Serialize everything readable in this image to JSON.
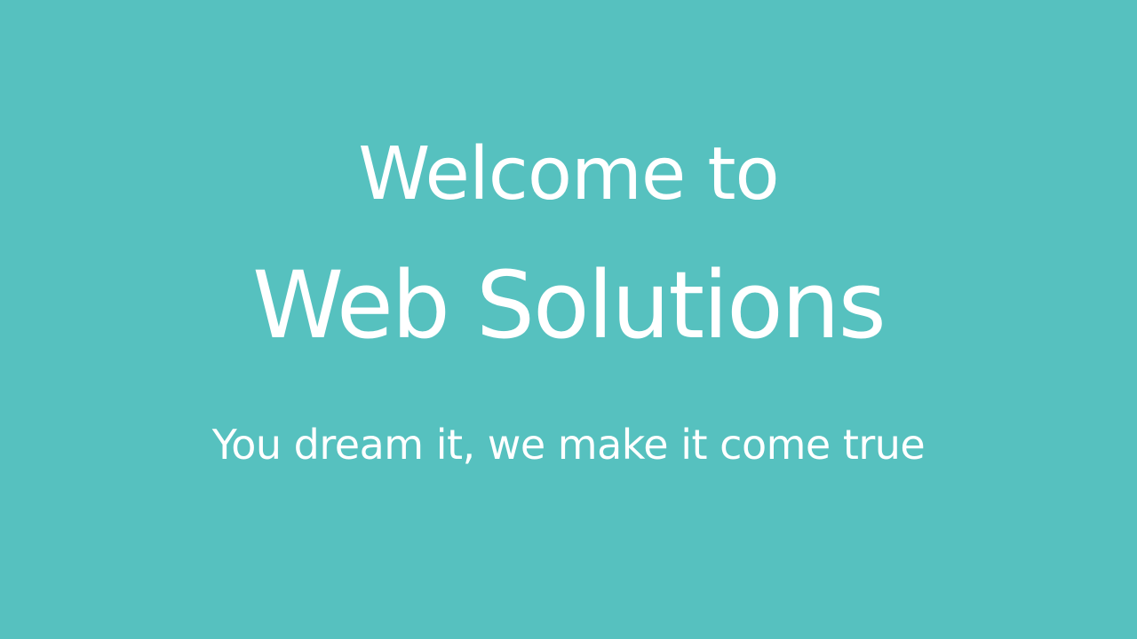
{
  "slide": {
    "title_line1": "Welcome to",
    "title_line2": "Web Solutions",
    "tagline": "You dream it, we make it come true"
  },
  "colors": {
    "background": "#56c1bf",
    "text": "#ffffff"
  }
}
